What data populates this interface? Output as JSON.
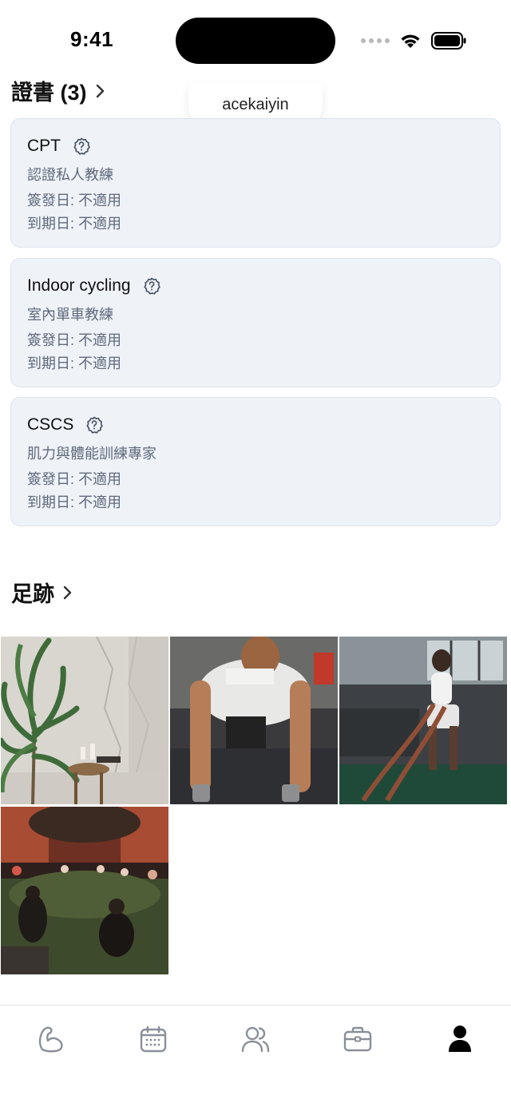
{
  "status_bar": {
    "time": "9:41"
  },
  "username_tooltip": "acekaiyin",
  "certificates": {
    "heading": "證書 (3)",
    "items": [
      {
        "name": "CPT",
        "description": "認證私人教練",
        "issued": "簽發日: 不適用",
        "expires": "到期日: 不適用"
      },
      {
        "name": "Indoor cycling",
        "description": "室內單車教練",
        "issued": "簽發日: 不適用",
        "expires": "到期日: 不適用"
      },
      {
        "name": "CSCS",
        "description": "肌力與體能訓練專家",
        "issued": "簽發日: 不適用",
        "expires": "到期日: 不適用"
      }
    ]
  },
  "footprints": {
    "heading": "足跡",
    "photos": [
      "candle-table-plant-photo",
      "pushup-dumbbell-photo",
      "battle-ropes-photo",
      "outdoor-yoga-group-photo"
    ]
  },
  "tab_bar": {
    "tabs": [
      "bicep-icon",
      "calendar-icon",
      "users-icon",
      "briefcase-icon",
      "profile-icon"
    ],
    "active_tab": "profile-icon",
    "colors": {
      "active": "#000000",
      "inactive": "#8a8f99"
    }
  }
}
